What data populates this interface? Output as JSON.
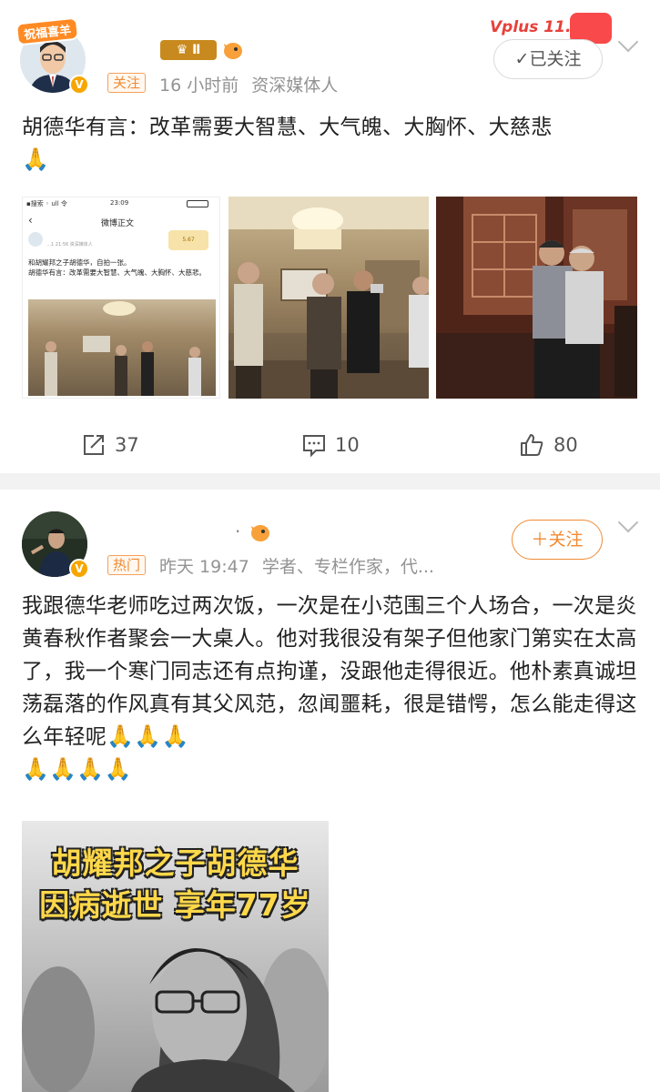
{
  "post1": {
    "avatar_badge": "祝福喜羊",
    "level_badge": "Ⅱ",
    "follow_button": "已关注",
    "promo_badge": "Vplus 11.11",
    "tag": "关注",
    "time": "16 小时前",
    "author_desc": "资深媒体人",
    "text": "胡德华有言：改革需要大智慧、大气魄、大胸怀、大慈悲",
    "emoji": "🙏",
    "screenshot": {
      "status_left": "▪搜索 ◦ ull 令",
      "status_time": "23:09",
      "nav_title": "微博正文",
      "meta": "…1 21:56 资深媒体人",
      "line1": "和胡耀邦之子胡德华，自拍一张。",
      "line2": "胡德华有言：改革需要大智慧、大气魄、大胸怀、大慈悲。",
      "badge": "5.67"
    },
    "actions": {
      "reposts": "37",
      "comments": "10",
      "likes": "80"
    }
  },
  "post2": {
    "follow_button": "关注",
    "tag": "热门",
    "time": "昨天 19:47",
    "author_desc": "学者、专栏作家，代...",
    "text": "我跟德华老师吃过两次饭，一次是在小范围三个人场合，一次是炎黄春秋作者聚会一大桌人。他对我很没有架子但他家门第实在太高了，我一个寒门同志还有点拘谨，没跟他走得很近。他朴素真诚坦荡磊落的作风真有其父风范，忽闻噩耗，很是错愕，怎么能走得这么年轻呢",
    "emojis_inline": "🙏🙏🙏",
    "emojis_line": "🙏🙏🙏🙏",
    "image_headline1": "胡耀邦之子胡德华",
    "image_headline2": "因病逝世 享年77岁"
  },
  "colors": {
    "accent_orange": "#f08a33",
    "meta_gray": "#939393",
    "separator": "#f2f2f2"
  }
}
